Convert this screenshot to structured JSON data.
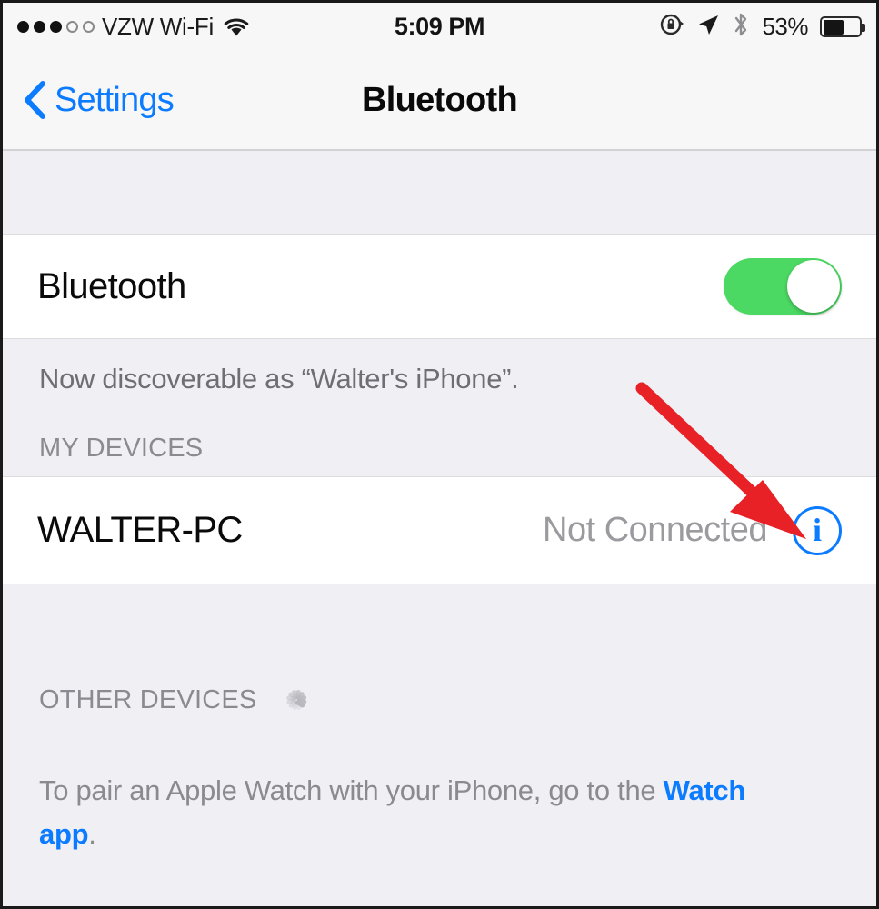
{
  "status_bar": {
    "signal_dots_filled": 3,
    "signal_dots_empty": 2,
    "carrier": "VZW Wi-Fi",
    "wifi_icon": "wifi-icon",
    "time": "5:09 PM",
    "rotation_lock_icon": "rotation-lock-icon",
    "location_icon": "location-arrow-icon",
    "bluetooth_icon": "bluetooth-icon",
    "battery_percent_label": "53%",
    "battery_level": 53
  },
  "nav": {
    "back_label": "Settings",
    "back_icon": "chevron-left-icon",
    "title": "Bluetooth"
  },
  "bluetooth_row": {
    "label": "Bluetooth",
    "toggle_state": "on",
    "toggle_on_color": "#4CD963"
  },
  "discoverable_note": "Now discoverable as “Walter's iPhone”.",
  "my_devices": {
    "header": "MY DEVICES",
    "devices": [
      {
        "name": "WALTER-PC",
        "status": "Not Connected",
        "info_icon": "info-icon",
        "info_icon_color": "#0b7bff"
      }
    ]
  },
  "other_devices": {
    "header": "OTHER DEVICES",
    "spinner_icon": "activity-spinner-icon",
    "footer_text": "To pair an Apple Watch with your iPhone, go to the ",
    "footer_link": "Watch app",
    "footer_suffix": "."
  },
  "annotation": {
    "type": "arrow",
    "color": "#E82127",
    "points_to": "info-icon"
  }
}
